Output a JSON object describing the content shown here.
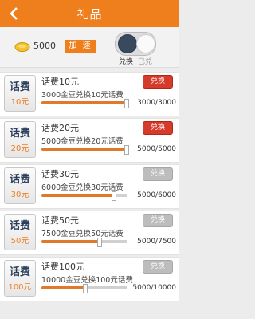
{
  "header": {
    "title": "礼品"
  },
  "topbar": {
    "balance": "5000",
    "speed_label": "加 速",
    "toggle_on_label": "兑换",
    "toggle_off_label": "已兑"
  },
  "items": [
    {
      "badge_title": "话费",
      "badge_amount": "10元",
      "name": "话费10元",
      "desc": "3000金豆兑换10元话费",
      "progress": "3000/3000",
      "ratio": 1.0,
      "button": "兑换",
      "state": "active"
    },
    {
      "badge_title": "话费",
      "badge_amount": "20元",
      "name": "话费20元",
      "desc": "5000金豆兑换20元话费",
      "progress": "5000/5000",
      "ratio": 1.0,
      "button": "兑换",
      "state": "active"
    },
    {
      "badge_title": "话费",
      "badge_amount": "30元",
      "name": "话费30元",
      "desc": "6000金豆兑换30元话费",
      "progress": "5000/6000",
      "ratio": 0.83,
      "button": "兑换",
      "state": "disabled"
    },
    {
      "badge_title": "话费",
      "badge_amount": "50元",
      "name": "话费50元",
      "desc": "7500金豆兑换50元话费",
      "progress": "5000/7500",
      "ratio": 0.67,
      "button": "兑换",
      "state": "disabled"
    },
    {
      "badge_title": "话费",
      "badge_amount": "100元",
      "name": "话费100元",
      "desc": "10000金豆兑换100元话费",
      "progress": "5000/10000",
      "ratio": 0.5,
      "button": "兑换",
      "state": "disabled"
    }
  ],
  "colors": {
    "accent": "#ef7e1d",
    "redeem_active": "#d63a2a",
    "redeem_disabled": "#bdbdbd"
  }
}
